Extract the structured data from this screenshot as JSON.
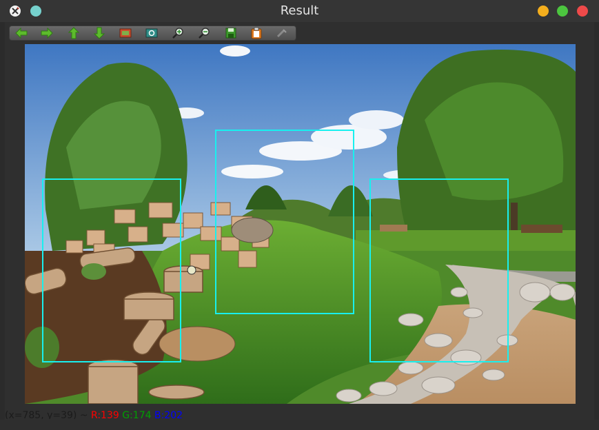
{
  "window": {
    "title": "Result",
    "buttons": [
      "app-icon",
      "pin-icon",
      "minimize-icon",
      "maximize-icon",
      "close-icon"
    ],
    "colors": {
      "minimize": "#f4ae1d",
      "maximize": "#4cc53f",
      "close": "#ee4a4a",
      "pin": "#76d1cd"
    }
  },
  "toolbar": {
    "tools": [
      {
        "name": "pan-left",
        "icon": "arrow-left-icon"
      },
      {
        "name": "pan-right",
        "icon": "arrow-right-icon"
      },
      {
        "name": "pan-up",
        "icon": "arrow-up-icon"
      },
      {
        "name": "pan-down",
        "icon": "arrow-down-icon"
      },
      {
        "name": "zoom-fit",
        "icon": "zoom-fit-icon"
      },
      {
        "name": "zoom-original",
        "icon": "zoom-original-icon"
      },
      {
        "name": "zoom-in",
        "icon": "zoom-in-icon"
      },
      {
        "name": "zoom-out",
        "icon": "zoom-out-icon"
      },
      {
        "name": "save",
        "icon": "save-icon"
      },
      {
        "name": "copy",
        "icon": "clipboard-icon"
      },
      {
        "name": "properties",
        "icon": "settings-icon"
      }
    ]
  },
  "image": {
    "description_icon": "photo-park-landscape",
    "box_color": "#18f0ef",
    "box_count": 3
  },
  "status": {
    "coords": "(x=785, y=39) ~",
    "r": "R:139",
    "g": "G:174",
    "b": "B:202"
  }
}
